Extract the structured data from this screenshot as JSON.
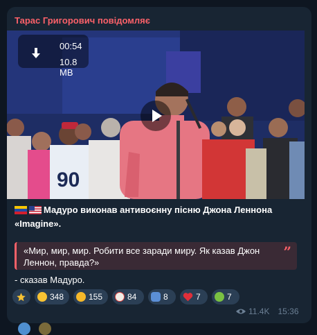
{
  "channel": {
    "name": "Тарас Григорович повідомляє"
  },
  "video": {
    "duration": "00:54",
    "size": "10.8 MB"
  },
  "message": {
    "title": "Мадуро виконав антивоєнну пісню Джона Леннона «Imagine».",
    "quote": "«Мир, мир, мир. Робити все заради миру. Як казав Джон Леннон, правда?»",
    "attribution": "- сказав Мадуро."
  },
  "reactions": [
    {
      "emoji": "star",
      "count": ""
    },
    {
      "emoji": "grinning-face",
      "count": "348"
    },
    {
      "emoji": "rofl-face",
      "count": "155"
    },
    {
      "emoji": "clown-face",
      "count": "84"
    },
    {
      "emoji": "person-shrugging",
      "count": "8"
    },
    {
      "emoji": "red-heart",
      "count": "7"
    },
    {
      "emoji": "nauseated-face",
      "count": "7"
    }
  ],
  "meta": {
    "views": "11.4K",
    "time": "15:36"
  },
  "colors": {
    "accent": "#fb6169",
    "bubble": "#182533",
    "background": "#0e1621",
    "meta": "#6b7f94"
  }
}
